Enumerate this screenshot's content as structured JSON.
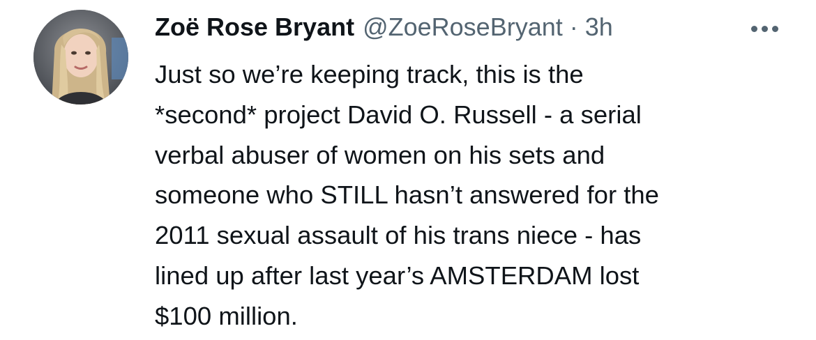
{
  "tweet": {
    "author": {
      "name": "Zoë Rose Bryant",
      "handle": "@ZoeRoseBryant",
      "separator": "·",
      "time": "3h"
    },
    "more_icon": "ellipsis-horizontal-icon",
    "text_lines": [
      "Just so we’re keeping track, this is the",
      "*second* project David O. Russell - a serial",
      "verbal abuser of women on his sets and",
      "someone who STILL hasn’t answered for the",
      "2011 sexual assault of his trans niece - has",
      "lined up after last year’s AMSTERDAM lost",
      "$100 million."
    ],
    "colors": {
      "text": "#0f1419",
      "secondary": "#536471",
      "background": "#ffffff"
    }
  }
}
